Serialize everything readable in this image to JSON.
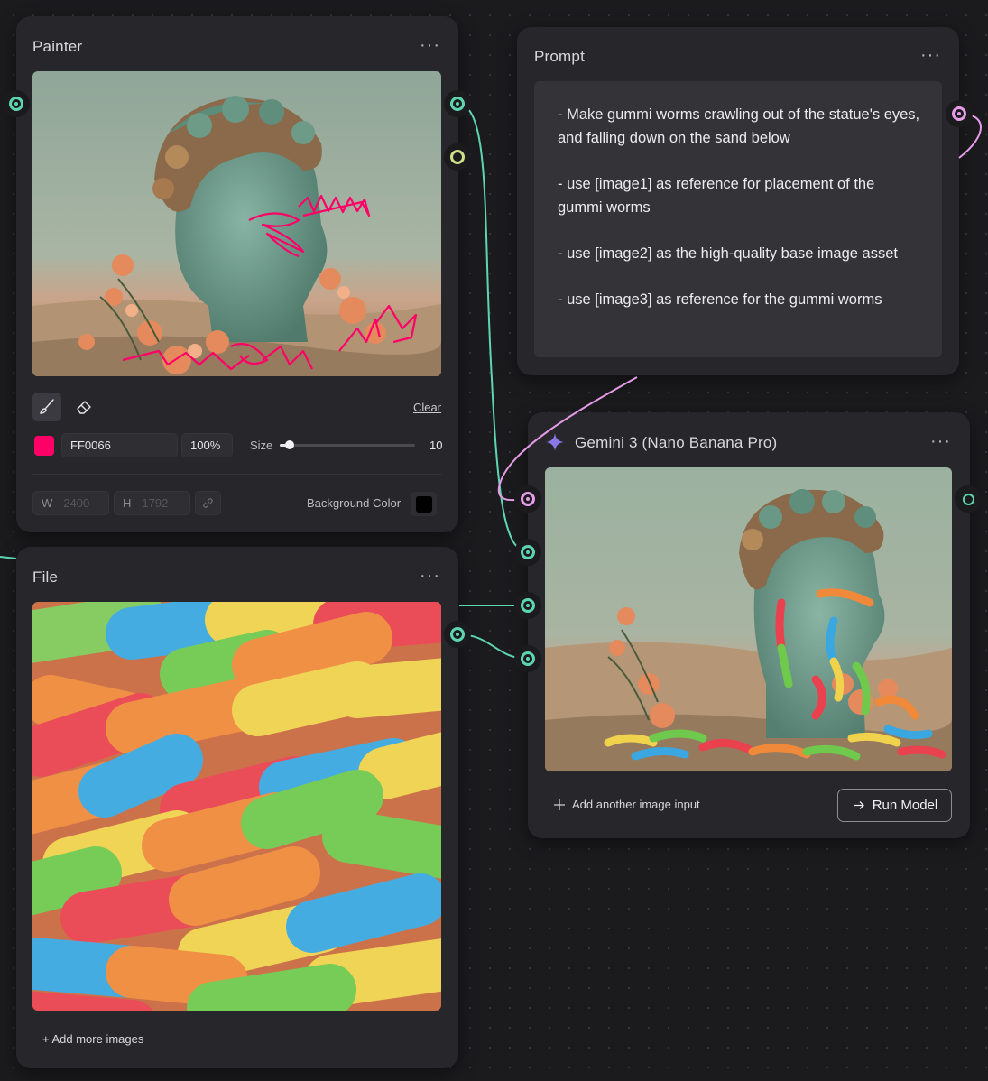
{
  "colors": {
    "canvas": "#1b1b1e",
    "node": "#27272b",
    "teal_port": "#5dd6b0",
    "pink_port": "#e59be7",
    "yellow_port": "#cfe08a",
    "brush": "#FF0066"
  },
  "painter": {
    "title": "Painter",
    "menu": "···",
    "clear_label": "Clear",
    "tools": {
      "brush": "brush-icon",
      "eraser": "eraser-icon"
    },
    "color_hex": "FF0066",
    "opacity": "100%",
    "size_label": "Size",
    "size_value": "10",
    "size_fraction": 0.07,
    "width_label": "W",
    "width_value": "2400",
    "height_label": "H",
    "height_value": "1792",
    "link_icon": "link-icon",
    "background_label": "Background Color",
    "background_color": "#000000"
  },
  "file": {
    "title": "File",
    "menu": "···",
    "add_label": "+ Add more images"
  },
  "prompt": {
    "title": "Prompt",
    "menu": "···",
    "lines": [
      "- Make gummi worms crawling out of the statue's eyes, and falling down on the sand below",
      "- use [image1] as reference for placement of the gummi worms",
      "- use [image2] as the high-quality base image asset",
      "- use [image3] as reference for the gummi worms"
    ]
  },
  "model": {
    "title": "Gemini 3 (Nano Banana Pro)",
    "icon": "sparkle-icon",
    "menu": "···",
    "add_input_label": "Add another image input",
    "run_label": "Run Model"
  }
}
